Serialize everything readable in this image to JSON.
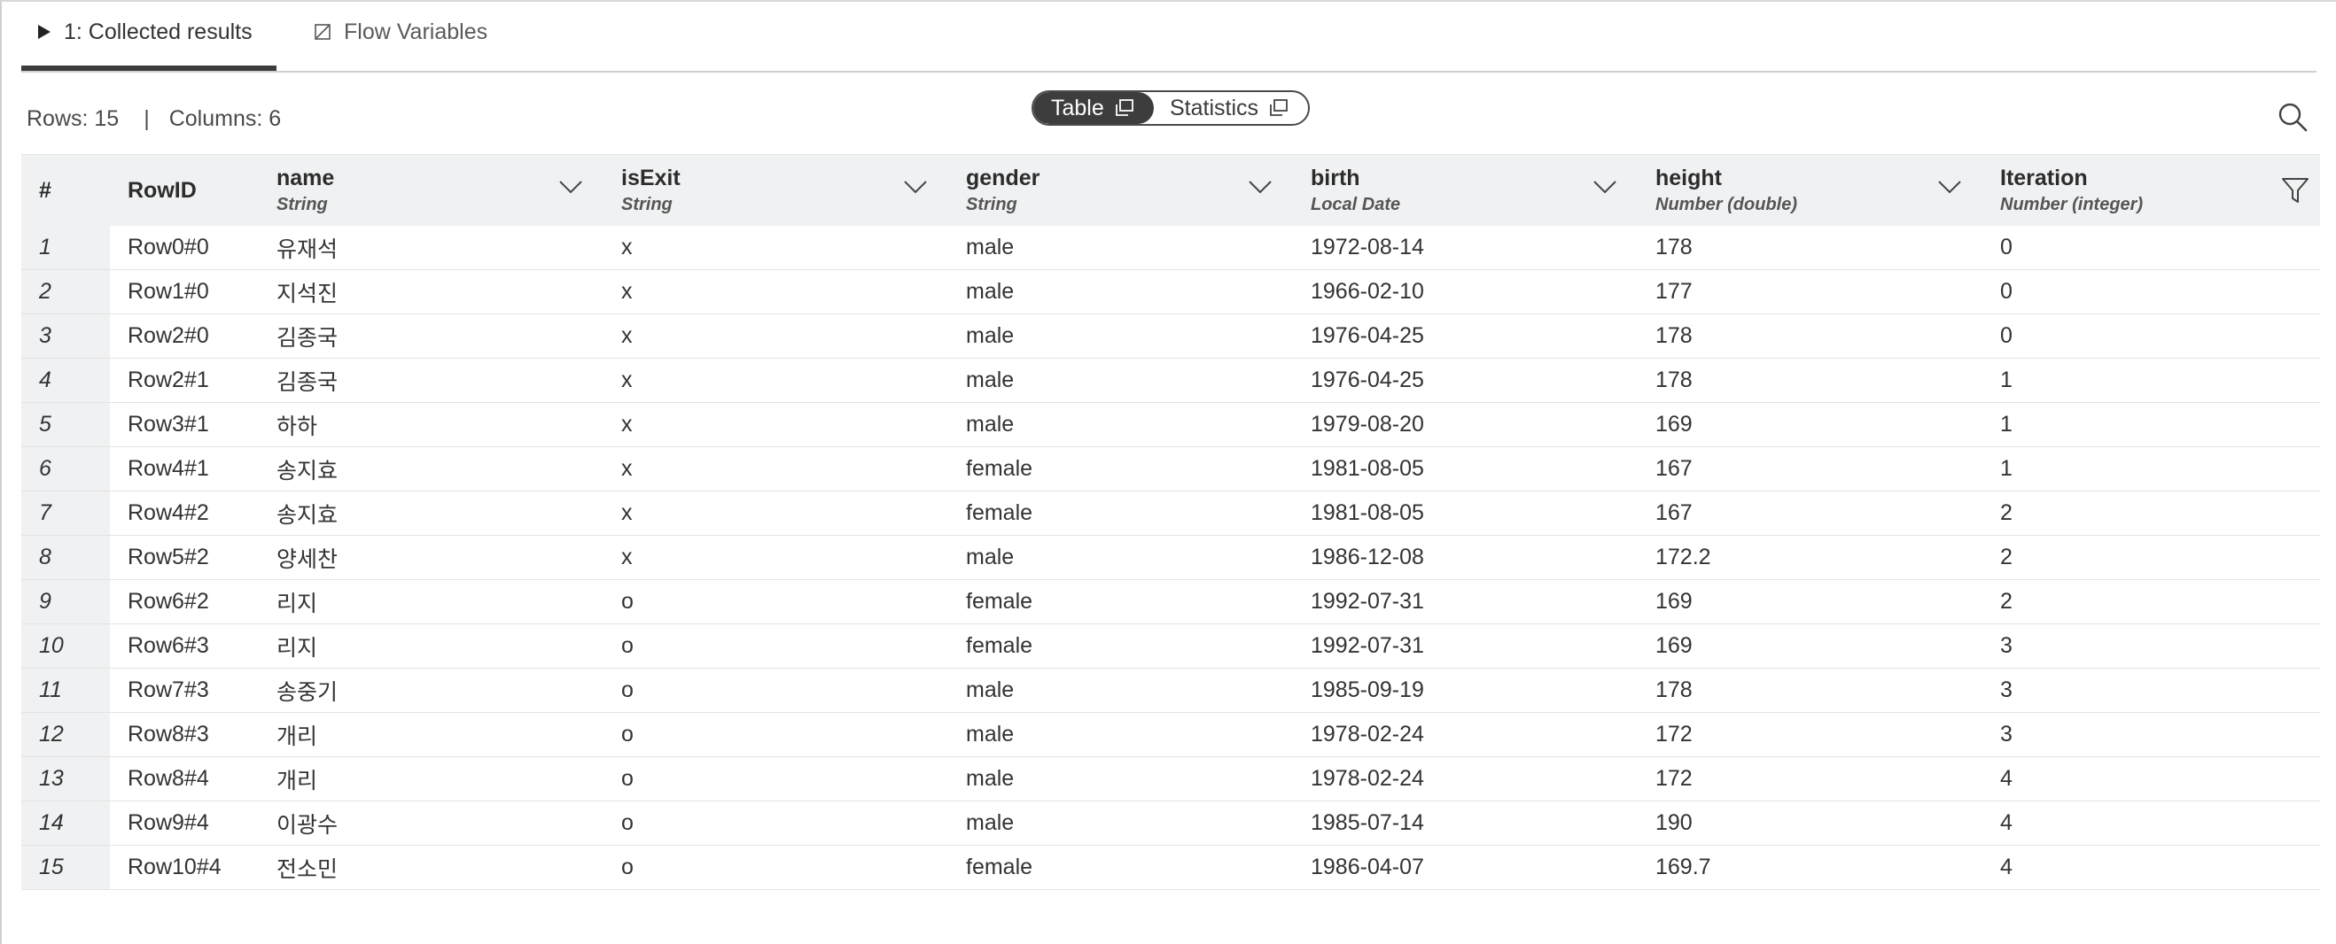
{
  "tabs": [
    {
      "label": "1: Collected results",
      "icon": "play-triangle-icon",
      "active": true
    },
    {
      "label": "Flow Variables",
      "icon": "flow-variable-icon",
      "active": false
    }
  ],
  "info": {
    "rows": "Rows: 15",
    "separator": "|",
    "columns": "Columns: 6"
  },
  "view_toggle": {
    "table_label": "Table",
    "statistics_label": "Statistics"
  },
  "table": {
    "index_header": "#",
    "rowid_header": "RowID",
    "columns": [
      {
        "name": "name",
        "type": "String"
      },
      {
        "name": "isExit",
        "type": "String"
      },
      {
        "name": "gender",
        "type": "String"
      },
      {
        "name": "birth",
        "type": "Local Date"
      },
      {
        "name": "height",
        "type": "Number (double)"
      },
      {
        "name": "Iteration",
        "type": "Number (integer)"
      }
    ],
    "rows": [
      {
        "idx": "1",
        "rowid": "Row0#0",
        "cells": [
          "유재석",
          "x",
          "male",
          "1972-08-14",
          "178",
          "0"
        ]
      },
      {
        "idx": "2",
        "rowid": "Row1#0",
        "cells": [
          "지석진",
          "x",
          "male",
          "1966-02-10",
          "177",
          "0"
        ]
      },
      {
        "idx": "3",
        "rowid": "Row2#0",
        "cells": [
          "김종국",
          "x",
          "male",
          "1976-04-25",
          "178",
          "0"
        ]
      },
      {
        "idx": "4",
        "rowid": "Row2#1",
        "cells": [
          "김종국",
          "x",
          "male",
          "1976-04-25",
          "178",
          "1"
        ]
      },
      {
        "idx": "5",
        "rowid": "Row3#1",
        "cells": [
          "하하",
          "x",
          "male",
          "1979-08-20",
          "169",
          "1"
        ]
      },
      {
        "idx": "6",
        "rowid": "Row4#1",
        "cells": [
          "송지효",
          "x",
          "female",
          "1981-08-05",
          "167",
          "1"
        ]
      },
      {
        "idx": "7",
        "rowid": "Row4#2",
        "cells": [
          "송지효",
          "x",
          "female",
          "1981-08-05",
          "167",
          "2"
        ]
      },
      {
        "idx": "8",
        "rowid": "Row5#2",
        "cells": [
          "양세찬",
          "x",
          "male",
          "1986-12-08",
          "172.2",
          "2"
        ]
      },
      {
        "idx": "9",
        "rowid": "Row6#2",
        "cells": [
          "리지",
          "o",
          "female",
          "1992-07-31",
          "169",
          "2"
        ]
      },
      {
        "idx": "10",
        "rowid": "Row6#3",
        "cells": [
          "리지",
          "o",
          "female",
          "1992-07-31",
          "169",
          "3"
        ]
      },
      {
        "idx": "11",
        "rowid": "Row7#3",
        "cells": [
          "송중기",
          "o",
          "male",
          "1985-09-19",
          "178",
          "3"
        ]
      },
      {
        "idx": "12",
        "rowid": "Row8#3",
        "cells": [
          "개리",
          "o",
          "male",
          "1978-02-24",
          "172",
          "3"
        ]
      },
      {
        "idx": "13",
        "rowid": "Row8#4",
        "cells": [
          "개리",
          "o",
          "male",
          "1978-02-24",
          "172",
          "4"
        ]
      },
      {
        "idx": "14",
        "rowid": "Row9#4",
        "cells": [
          "이광수",
          "o",
          "male",
          "1985-07-14",
          "190",
          "4"
        ]
      },
      {
        "idx": "15",
        "rowid": "Row10#4",
        "cells": [
          "전소민",
          "o",
          "female",
          "1986-04-07",
          "169.7",
          "4"
        ]
      }
    ]
  }
}
